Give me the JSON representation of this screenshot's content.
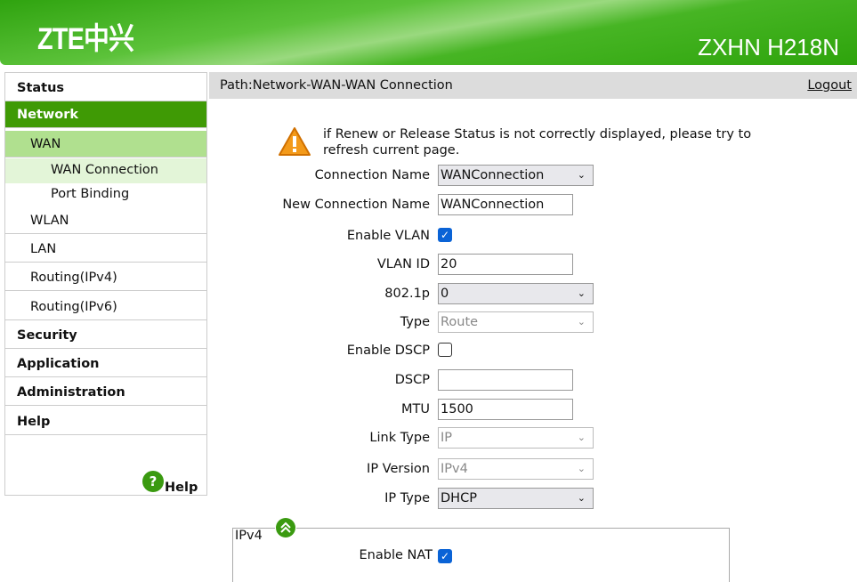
{
  "header": {
    "logo": "ZTE中兴",
    "model": "ZXHN H218N"
  },
  "sidebar": {
    "items": [
      {
        "label": "Status",
        "level": 1
      },
      {
        "label": "Network",
        "level": 1,
        "active": true
      },
      {
        "label": "WAN",
        "level": 2,
        "active": true
      },
      {
        "label": "WAN Connection",
        "level": 3,
        "active": true
      },
      {
        "label": "Port Binding",
        "level": 3
      },
      {
        "label": "WLAN",
        "level": 2
      },
      {
        "label": "LAN",
        "level": 2
      },
      {
        "label": "Routing(IPv4)",
        "level": 2
      },
      {
        "label": "Routing(IPv6)",
        "level": 2
      },
      {
        "label": "Security",
        "level": 1
      },
      {
        "label": "Application",
        "level": 1
      },
      {
        "label": "Administration",
        "level": 1
      },
      {
        "label": "Help",
        "level": 1
      }
    ],
    "help_label": "Help"
  },
  "pathbar": {
    "path": "Path:Network-WAN-WAN Connection",
    "logout": "Logout"
  },
  "warning": "if Renew or Release Status is not correctly displayed, please try to refresh current page.",
  "form": {
    "connection_name": {
      "label": "Connection Name",
      "value": "WANConnection"
    },
    "new_connection_name": {
      "label": "New Connection Name",
      "value": "WANConnection"
    },
    "enable_vlan": {
      "label": "Enable VLAN",
      "checked": true
    },
    "vlan_id": {
      "label": "VLAN ID",
      "value": "20"
    },
    "dot1p": {
      "label": "802.1p",
      "value": "0"
    },
    "type": {
      "label": "Type",
      "value": "Route"
    },
    "enable_dscp": {
      "label": "Enable DSCP",
      "checked": false
    },
    "dscp": {
      "label": "DSCP",
      "value": ""
    },
    "mtu": {
      "label": "MTU",
      "value": "1500"
    },
    "link_type": {
      "label": "Link Type",
      "value": "IP"
    },
    "ip_version": {
      "label": "IP Version",
      "value": "IPv4"
    },
    "ip_type": {
      "label": "IP Type",
      "value": "DHCP"
    }
  },
  "ipv4": {
    "legend": "IPv4",
    "enable_nat": {
      "label": "Enable NAT",
      "checked": true
    }
  },
  "colors": {
    "nav_active": "#3f9a05",
    "nav_sub": "#b0e08f",
    "nav_subsub": "#e3f5d8",
    "checkbox": "#0a63d6"
  }
}
